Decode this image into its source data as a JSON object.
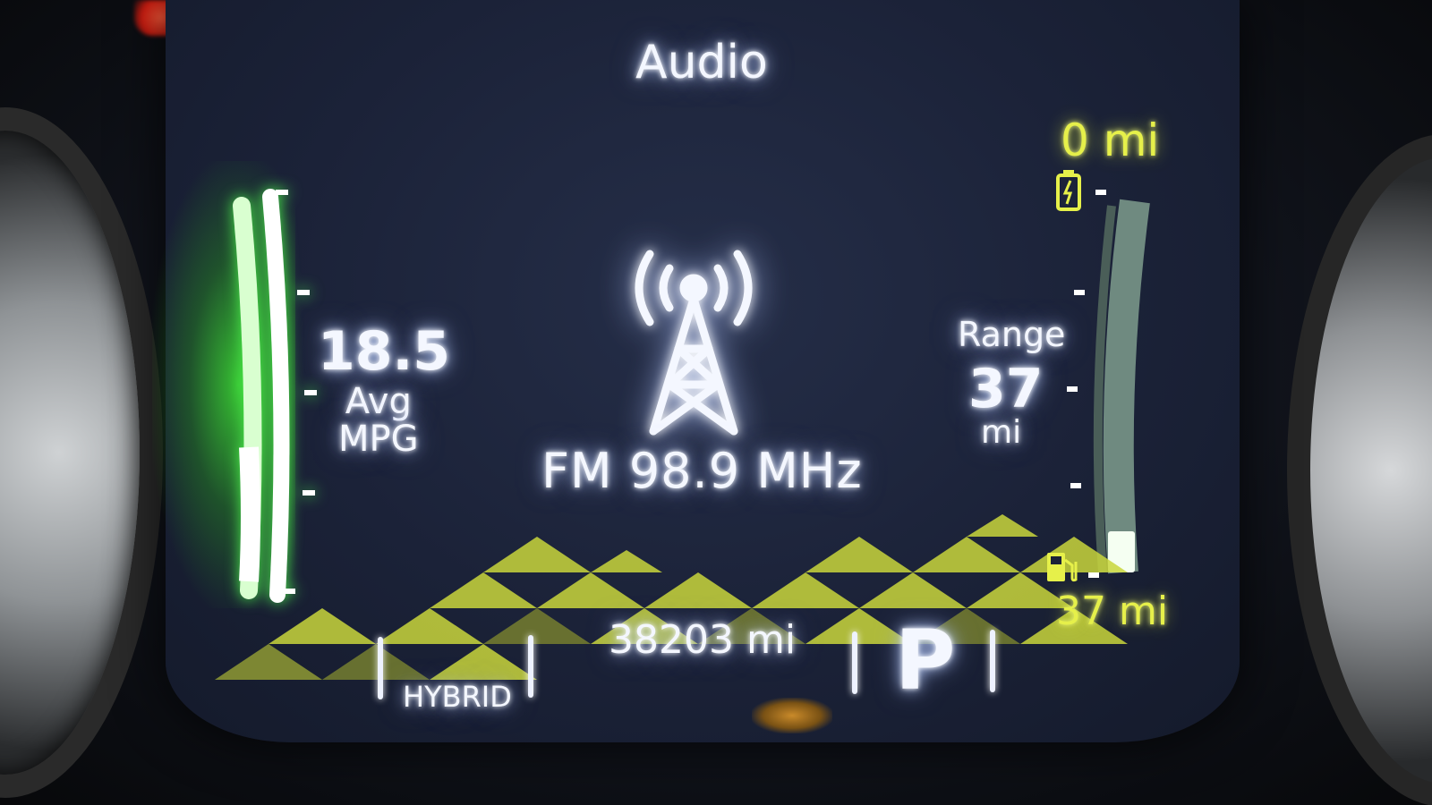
{
  "screen": {
    "title": "Audio",
    "source": "FM 98.9 MHz"
  },
  "avg_mpg": {
    "value": "18.5",
    "label_line1": "Avg",
    "label_line2": "MPG"
  },
  "range": {
    "label": "Range",
    "value": "37",
    "unit": "mi"
  },
  "electric_range": "0 mi",
  "fuel_range": "37 mi",
  "fuel_level_fraction": 0.08,
  "odometer": "38203 mi",
  "gear": "P",
  "mode": "HYBRID",
  "icons": {
    "radio": "radio-tower-icon",
    "battery": "battery-icon",
    "fuel": "fuel-pump-icon"
  },
  "colors": {
    "display_bg": "#1b2238",
    "glow_white": "#f4f7ff",
    "ev_yellow": "#e6f04a",
    "eco_green": "#4cff3c"
  }
}
